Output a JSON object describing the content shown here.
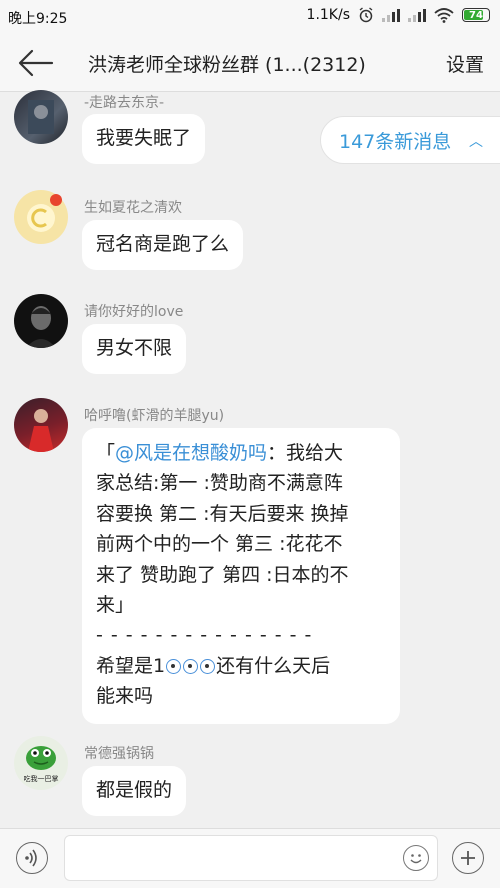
{
  "status_bar": {
    "time": "晚上9:25",
    "net_speed": "1.1K/s",
    "battery": "74"
  },
  "header": {
    "title": "洪涛老师全球粉丝群 (1...(2312)",
    "settings_label": "设置"
  },
  "new_messages": {
    "label": "147条新消息"
  },
  "messages": [
    {
      "sender": "-走路去东京-",
      "text": "我要失眠了"
    },
    {
      "sender": "生如夏花之清欢",
      "text": "冠名商是跑了么"
    },
    {
      "sender": "请你好好的love",
      "text": "男女不限"
    },
    {
      "sender": "哈呼噜(虾滑的羊腿yu)",
      "quote_open": "「",
      "mention": "@风是在想酸奶吗",
      "line1_rest": "：我给大",
      "line2": "家总结:第一 :赞助商不满意阵",
      "line3": "容要换 第二 :有天后要来 换掉",
      "line4": "前两个中的一个 第三 :花花不",
      "line5": "来了 赞助跑了 第四 :日本的不",
      "line6": "来」",
      "divider": "- - - - - - - - - - - - - - -",
      "line7a": "希望是1",
      "line7b": "还有什么天后",
      "line8": "能来吗"
    },
    {
      "sender": "常德强锅锅",
      "text": "都是假的",
      "avatar_caption": "吃我一巴掌"
    }
  ],
  "colors": {
    "accent": "#3a9ad9",
    "mention": "#3a8fd6",
    "background": "#f0f0f0"
  }
}
